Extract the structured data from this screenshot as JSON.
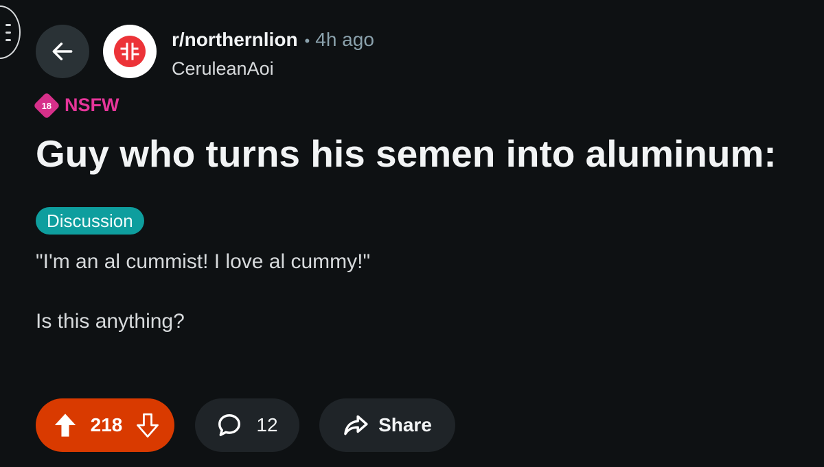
{
  "post": {
    "subreddit": "r/northernlion",
    "separator": "•",
    "time_ago": "4h ago",
    "author": "CeruleanAoi",
    "nsfw_badge": "18",
    "nsfw_label": "NSFW",
    "title": "Guy who turns his semen into aluminum:",
    "flair": "Discussion",
    "body": [
      "\"I'm an al cummist! I love al cummy!\"",
      "Is this anything?"
    ]
  },
  "actions": {
    "vote_count": "218",
    "comment_count": "12",
    "share_label": "Share"
  },
  "icons": {
    "menu": "hamburger-menu-icon",
    "back": "arrow-left-icon",
    "subreddit": "subreddit-logo-icon",
    "upvote": "arrow-up-icon",
    "downvote": "arrow-down-icon",
    "comment": "speech-bubble-icon",
    "share": "share-arrow-icon"
  },
  "colors": {
    "background": "#0e1113",
    "vote_active": "#d93a00",
    "nsfw": "#e6359a",
    "flair": "#0e9e9e",
    "subreddit_logo": "#ec3338"
  }
}
